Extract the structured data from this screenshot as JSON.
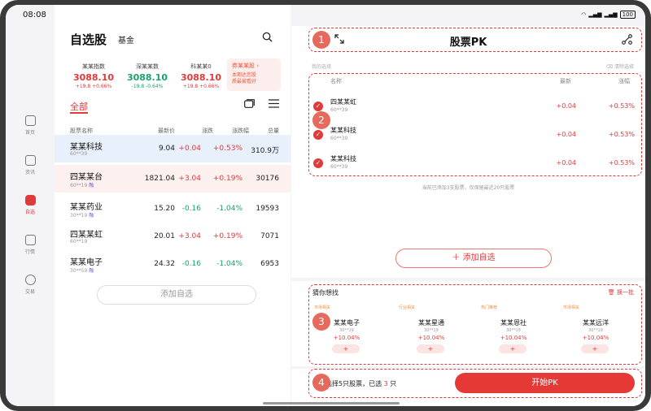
{
  "status": {
    "time": "08:08",
    "battery": "100"
  },
  "rail": [
    {
      "label": "首页",
      "active": false
    },
    {
      "label": "资讯",
      "active": false
    },
    {
      "label": "自选",
      "active": true
    },
    {
      "label": "行情",
      "active": false
    },
    {
      "label": "交易",
      "active": false
    }
  ],
  "left": {
    "title": "自选股",
    "fund_tab": "基金",
    "indices": [
      {
        "name": "某某指数",
        "value": "3088.10",
        "change": "+19.8 +0.66%",
        "dir": "up"
      },
      {
        "name": "深某某数",
        "value": "3088.10",
        "change": "-19.8 -0.64%",
        "dir": "down"
      },
      {
        "name": "科某某0",
        "value": "3088.10",
        "change": "+19.8 +0.66%",
        "dir": "up"
      }
    ],
    "promo": {
      "title": "券某某股",
      "line1": "本期达您股",
      "line2": "质最被看好"
    },
    "tab_all": "全部",
    "columns": [
      "股票名称",
      "最新价",
      "涨跌",
      "涨跌幅",
      "总量"
    ],
    "rows": [
      {
        "name": "某某科技",
        "code": "60**39",
        "badge": "",
        "price": "9.04",
        "chg": "+0.04",
        "pct": "+0.53%",
        "vol": "310.9万",
        "dir": "up"
      },
      {
        "name": "四某某台",
        "code": "60**19",
        "badge": "融",
        "price": "1821.04",
        "chg": "+3.04",
        "pct": "+0.19%",
        "vol": "30176",
        "dir": "up"
      },
      {
        "name": "某某药业",
        "code": "30**19",
        "badge": "融",
        "price": "15.20",
        "chg": "-0.16",
        "pct": "-1.04%",
        "vol": "19593",
        "dir": "down"
      },
      {
        "name": "四某某虹",
        "code": "60**19",
        "badge": "",
        "price": "20.01",
        "chg": "+3.04",
        "pct": "+0.19%",
        "vol": "7071",
        "dir": "up"
      },
      {
        "name": "某某电子",
        "code": "30**59",
        "badge": "融",
        "price": "24.32",
        "chg": "-0.16",
        "pct": "-1.04%",
        "vol": "6953",
        "dir": "down"
      }
    ],
    "add_label": "添加自选"
  },
  "right": {
    "title": "股票PK",
    "section_label": "我的选择",
    "clear_label": "清除选择",
    "columns": [
      "名称",
      "最新",
      "涨幅"
    ],
    "rows": [
      {
        "name": "四某某虹",
        "code": "60**39",
        "price": "+0.04",
        "pct": "+0.53%"
      },
      {
        "name": "某某科技",
        "code": "60**39",
        "price": "+0.04",
        "pct": "+0.53%"
      },
      {
        "name": "某某科技",
        "code": "60**39",
        "price": "+0.04",
        "pct": "+0.53%"
      }
    ],
    "note": "当前已添加3支股票，仅保留最近20只股票",
    "add_label": "添加自选",
    "guess_title": "猜你想找",
    "refresh_label": "换一批",
    "guess": [
      {
        "tag": "市场相关",
        "name": "某某电子",
        "code": "30**19",
        "pct": "+10.04%"
      },
      {
        "tag": "行业相关",
        "name": "某某星通",
        "code": "30**19",
        "pct": "+10.04%"
      },
      {
        "tag": "热门推荐",
        "name": "某某恩社",
        "code": "30**19",
        "pct": "+10.04%"
      },
      {
        "tag": "市场相关",
        "name": "某某远洋",
        "code": "30**19",
        "pct": "+10.04%"
      }
    ],
    "pick_prefix": "选择5只股票，已选",
    "pick_count": "3",
    "pick_suffix": "只",
    "start_label": "开始PK",
    "markers": [
      "1",
      "2",
      "3",
      "4"
    ]
  },
  "colors": {
    "accent": "#e03a3a",
    "up": "#e03a3a",
    "down": "#1aa36a",
    "selected_row": "#e8f0fc"
  }
}
